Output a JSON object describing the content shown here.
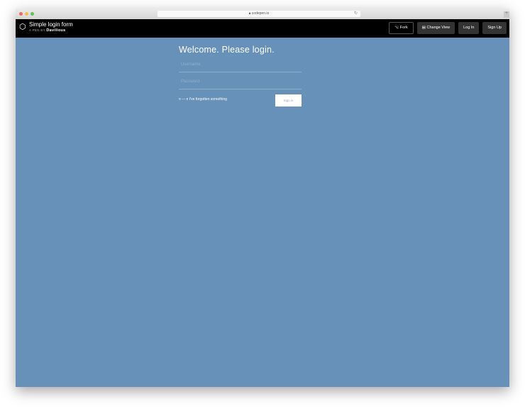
{
  "browser": {
    "url": "codepen.io",
    "colors": {
      "close": "#ee6a5f",
      "min": "#f5bd4f",
      "max": "#61c454"
    }
  },
  "header": {
    "title": "Simple login form",
    "byline": "A PEN BY",
    "author": "Davilious",
    "buttons": {
      "fork": "⌥ Fork",
      "change_view": "▤ Change View",
      "login": "Log In",
      "signup": "Sign Up"
    }
  },
  "form": {
    "heading": "Welcome. Please login.",
    "username_placeholder": "Username",
    "password_placeholder": "Password",
    "forgot": "¤ — ¤ I've forgotten something",
    "signin": "Sign in"
  },
  "colors": {
    "background": "#6791b8"
  }
}
